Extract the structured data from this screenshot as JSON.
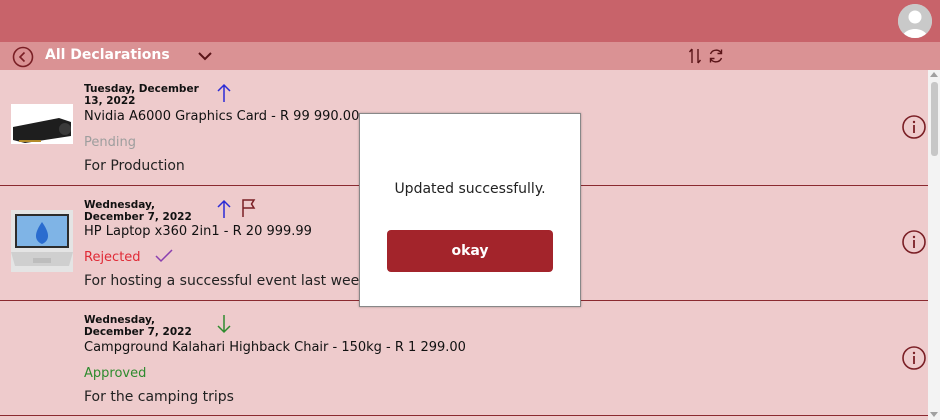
{
  "header": {
    "title": "All Declarations"
  },
  "icons": {
    "back": "back-circle-icon",
    "dropdown": "chevron-down-icon",
    "sort": "sort-icon",
    "refresh": "refresh-icon",
    "avatar": "user-avatar-icon",
    "info": "info-icon"
  },
  "declarations": [
    {
      "date": "Tuesday, December 13, 2022",
      "title": "Nvidia A6000 Graphics Card - R  99 990.00",
      "status": "Pending",
      "reason": "For Production",
      "direction": "up",
      "flagged": false,
      "checked": false
    },
    {
      "date": "Wednesday, December 7, 2022",
      "title": "HP Laptop x360 2in1 - R  20 999.99",
      "status": "Rejected",
      "reason": "For hosting a successful event last week.",
      "direction": "up",
      "flagged": true,
      "checked": true
    },
    {
      "date": "Wednesday, December 7, 2022",
      "title": "Campground Kalahari Highback Chair - 150kg - R  1 299.00",
      "status": "Approved",
      "reason": "For the camping trips",
      "direction": "down",
      "flagged": false,
      "checked": false
    }
  ],
  "dialog": {
    "message": "Updated successfully.",
    "button_label": "okay"
  },
  "colors": {
    "header_bar": "#c8636a",
    "sub_bar": "#da9294",
    "list_bg": "#eecbcc",
    "accent": "#a3242b",
    "status_pending": "#9e9e9e",
    "status_rejected": "#e02a36",
    "status_approved": "#2e8b2e",
    "arrow_up": "#2b2bd6",
    "arrow_down": "#2e8b2e"
  }
}
